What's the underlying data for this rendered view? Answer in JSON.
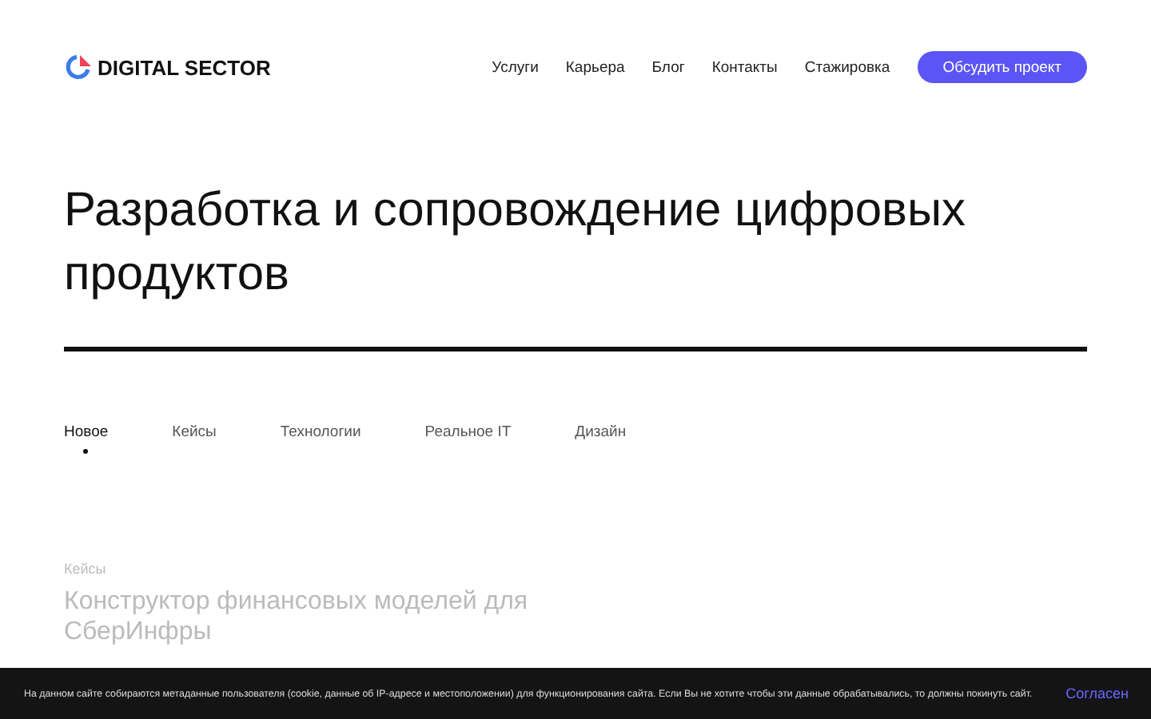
{
  "header": {
    "logo": "DIGITAL SECTOR",
    "nav": [
      "Услуги",
      "Карьера",
      "Блог",
      "Контакты",
      "Стажировка"
    ],
    "cta": "Обсудить проект"
  },
  "hero": {
    "title": "Разработка и сопровождение цифровых продуктов"
  },
  "tabs": [
    {
      "label": "Новое",
      "selected": true
    },
    {
      "label": "Кейсы",
      "selected": false
    },
    {
      "label": "Технологии",
      "selected": false
    },
    {
      "label": "Реальное IT",
      "selected": false
    },
    {
      "label": "Дизайн",
      "selected": false
    }
  ],
  "card": {
    "category": "Кейсы",
    "title": "Конструктор финансовых моделей для СберИнфры"
  },
  "cookie_bar": {
    "text": "На данном сайте собираются метаданные пользователя (cookie, данные об IP-адресе и местоположении) для функционирования сайта. Если Вы не хотите чтобы эти данные обрабатывались, то должны покинуть сайт.",
    "button": "Согласен"
  }
}
